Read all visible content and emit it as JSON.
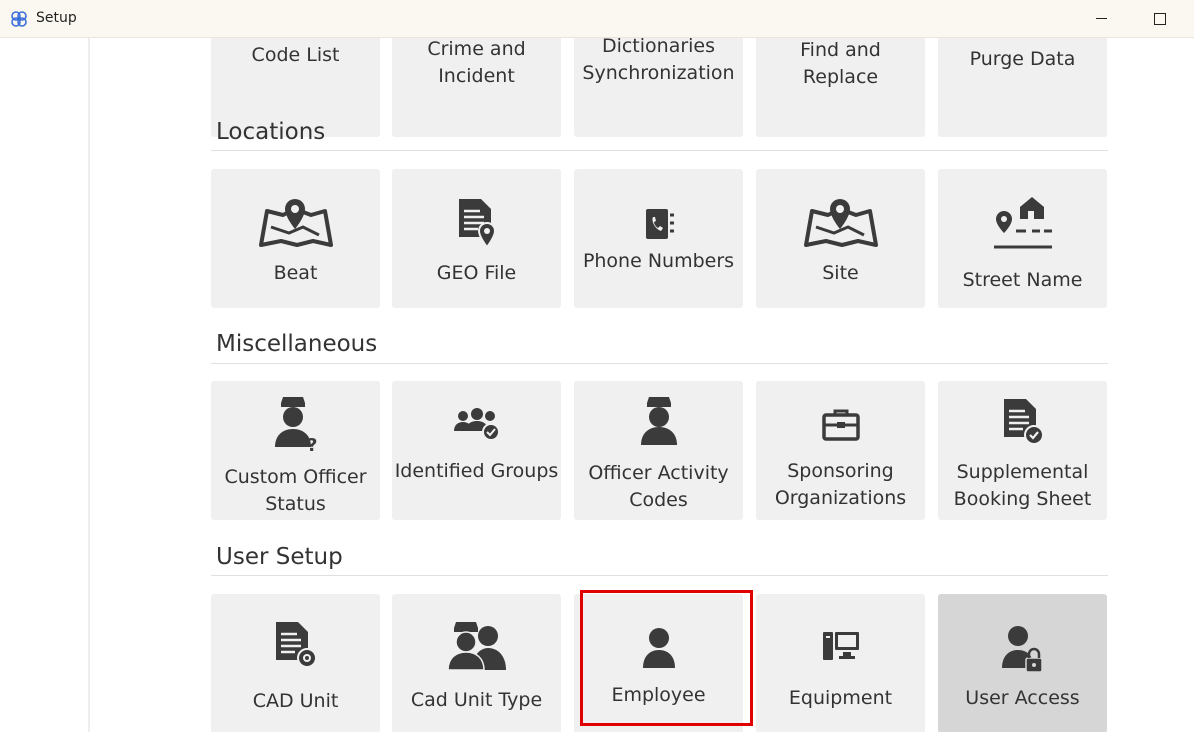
{
  "window": {
    "title": "Setup"
  },
  "sections": {
    "top": {
      "tiles": [
        "Code List",
        "Crime and Incident",
        "Dictionaries Synchronization",
        "Find and Replace",
        "Purge Data"
      ]
    },
    "locations": {
      "title": "Locations",
      "tiles": [
        "Beat",
        "GEO File",
        "Phone Numbers",
        "Site",
        "Street Name"
      ]
    },
    "misc": {
      "title": "Miscellaneous",
      "tiles": [
        "Custom Officer Status",
        "Identified Groups",
        "Officer Activity Codes",
        "Sponsoring Organizations",
        "Supplemental Booking Sheet"
      ]
    },
    "user_setup": {
      "title": "User Setup",
      "tiles": [
        "CAD Unit",
        "Cad Unit Type",
        "Employee",
        "Equipment",
        "User Access"
      ]
    }
  },
  "highlighted_tile": "Employee",
  "colors": {
    "icon": "#3b3b3b",
    "tile_bg": "#f0f0f0",
    "highlight": "#e00000"
  }
}
